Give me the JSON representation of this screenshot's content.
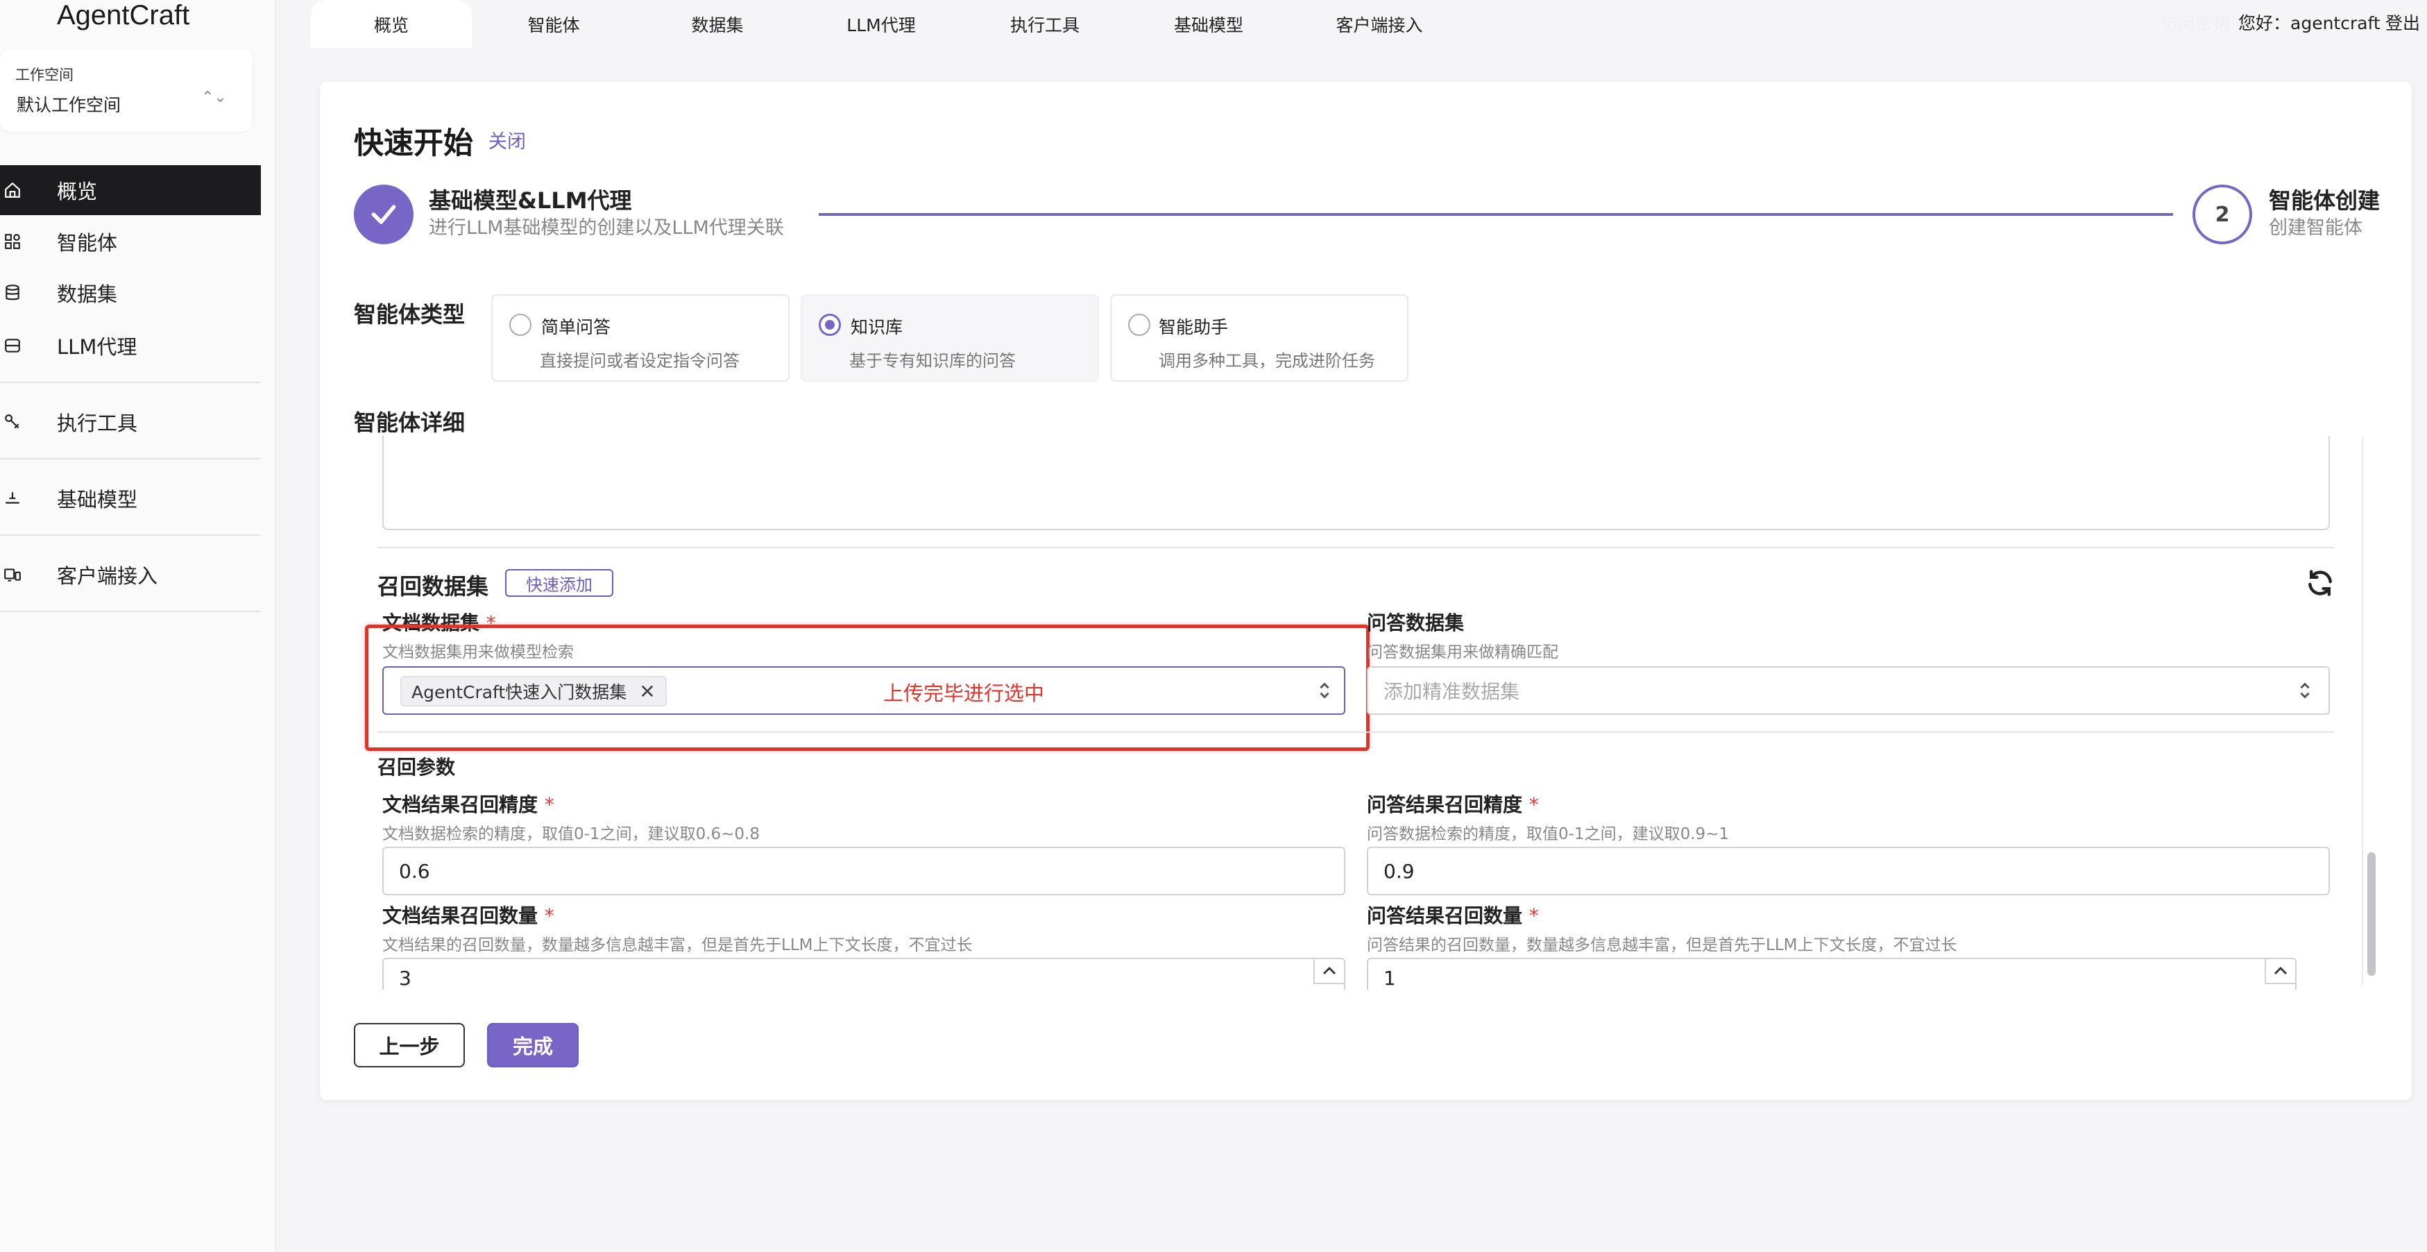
{
  "brand": {
    "logo": "AgentCraft"
  },
  "workspace": {
    "label": "工作空间",
    "value": "默认工作空间"
  },
  "sidebar": {
    "items": [
      {
        "label": "概览",
        "icon": "home-icon",
        "active": true
      },
      {
        "label": "智能体",
        "icon": "grid-icon"
      },
      {
        "label": "数据集",
        "icon": "database-icon"
      },
      {
        "label": "LLM代理",
        "icon": "server-icon"
      },
      {
        "label": "执行工具",
        "icon": "tool-icon"
      },
      {
        "label": "基础模型",
        "icon": "model-icon"
      },
      {
        "label": "客户端接入",
        "icon": "devices-icon"
      }
    ]
  },
  "topnav": {
    "tabs": [
      {
        "label": "概览",
        "active": true
      },
      {
        "label": "智能体"
      },
      {
        "label": "数据集"
      },
      {
        "label": "LLM代理"
      },
      {
        "label": "执行工具"
      },
      {
        "label": "基础模型"
      },
      {
        "label": "客户端接入"
      }
    ],
    "faded_text": "访问密钥",
    "greeting": "您好：agentcraft",
    "logout": "登出"
  },
  "quickstart": {
    "title": "快速开始",
    "close": "关闭",
    "steps": [
      {
        "title": "基础模型&LLM代理",
        "subtitle": "进行LLM基础模型的创建以及LLM代理关联",
        "status": "done"
      },
      {
        "number": "2",
        "title": "智能体创建",
        "subtitle": "创建智能体"
      }
    ]
  },
  "agent_type": {
    "label": "智能体类型",
    "options": [
      {
        "title": "简单问答",
        "desc": "直接提问或者设定指令问答",
        "selected": false
      },
      {
        "title": "知识库",
        "desc": "基于专有知识库的问答",
        "selected": true
      },
      {
        "title": "智能助手",
        "desc": "调用多种工具，完成进阶任务",
        "selected": false
      }
    ]
  },
  "agent_detail": {
    "label": "智能体详细"
  },
  "recall_dataset": {
    "label": "召回数据集",
    "quick_add": "快速添加",
    "doc": {
      "label": "文档数据集",
      "required": "*",
      "help": "文档数据集用来做模型检索",
      "chip": "AgentCraft快速入门数据集",
      "annotation": "上传完毕进行选中"
    },
    "qa": {
      "label": "问答数据集",
      "help": "问答数据集用来做精确匹配",
      "placeholder": "添加精准数据集"
    }
  },
  "recall_params": {
    "label": "召回参数",
    "doc_precision": {
      "label": "文档结果召回精度",
      "required": "*",
      "help": "文档数据检索的精度，取值0-1之间，建议取0.6~0.8",
      "value": "0.6"
    },
    "qa_precision": {
      "label": "问答结果召回精度",
      "required": "*",
      "help": "问答数据检索的精度，取值0-1之间，建议取0.9~1",
      "value": "0.9"
    },
    "doc_count": {
      "label": "文档结果召回数量",
      "required": "*",
      "help": "文档结果的召回数量，数量越多信息越丰富，但是首先于LLM上下文长度，不宜过长",
      "value": "3"
    },
    "qa_count": {
      "label": "问答结果召回数量",
      "required": "*",
      "help": "问答结果的召回数量，数量越多信息越丰富，但是首先于LLM上下文长度，不宜过长",
      "value": "1"
    }
  },
  "actions": {
    "prev": "上一步",
    "finish": "完成"
  },
  "colors": {
    "accent": "#7766c6",
    "annotation": "#e0342b",
    "sidebar_active": "#1c1c1e"
  }
}
